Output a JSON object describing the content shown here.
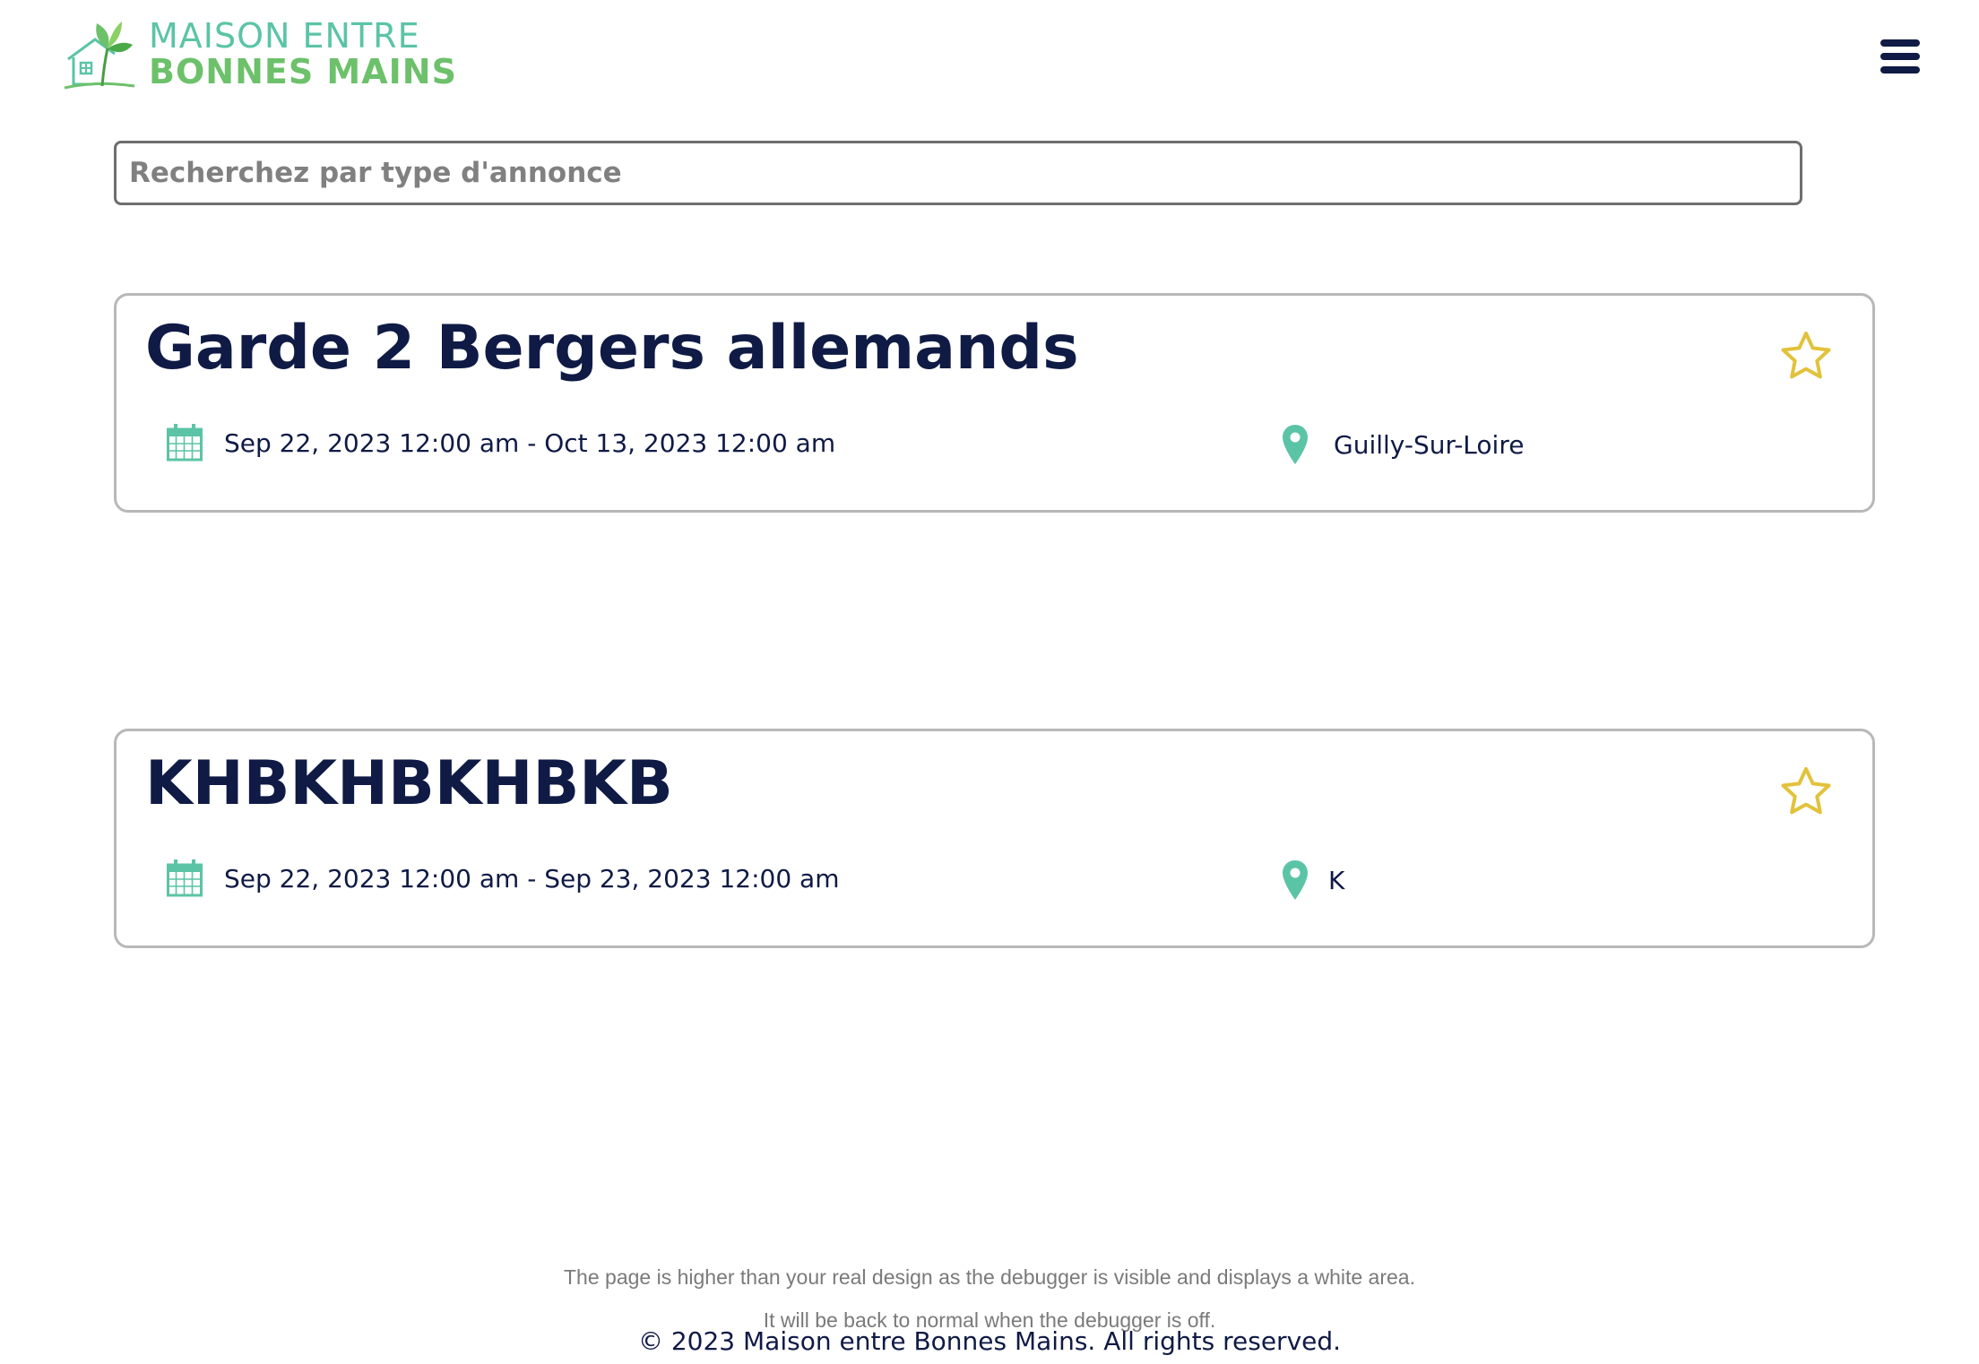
{
  "header": {
    "logo_line1": "MAISON ENTRE",
    "logo_line2": "BONNES MAINS",
    "menu_icon": "hamburger-menu-icon"
  },
  "search": {
    "placeholder": "Recherchez par type d'annonce",
    "value": ""
  },
  "listings": [
    {
      "title": "Garde 2 Bergers allemands",
      "dates": "Sep 22, 2023 12:00 am - Oct 13, 2023 12:00 am",
      "location": "Guilly-Sur-Loire",
      "favorite": false
    },
    {
      "title": "KHBKHBKHBKB",
      "dates": "Sep 22, 2023 12:00 am - Sep 23, 2023 12:00 am",
      "location": "K",
      "favorite": false
    }
  ],
  "debug_notice": {
    "line1": "The page is higher than your real design as the debugger is visible and displays a white area.",
    "line2": "It will be back to normal when the debugger is off."
  },
  "footer": {
    "copyright": "© 2023 Maison entre Bonnes Mains. All rights reserved."
  },
  "colors": {
    "navy": "#0f1a45",
    "teal": "#5bc4a6",
    "green": "#6cc16a",
    "star": "#e2c23b"
  }
}
